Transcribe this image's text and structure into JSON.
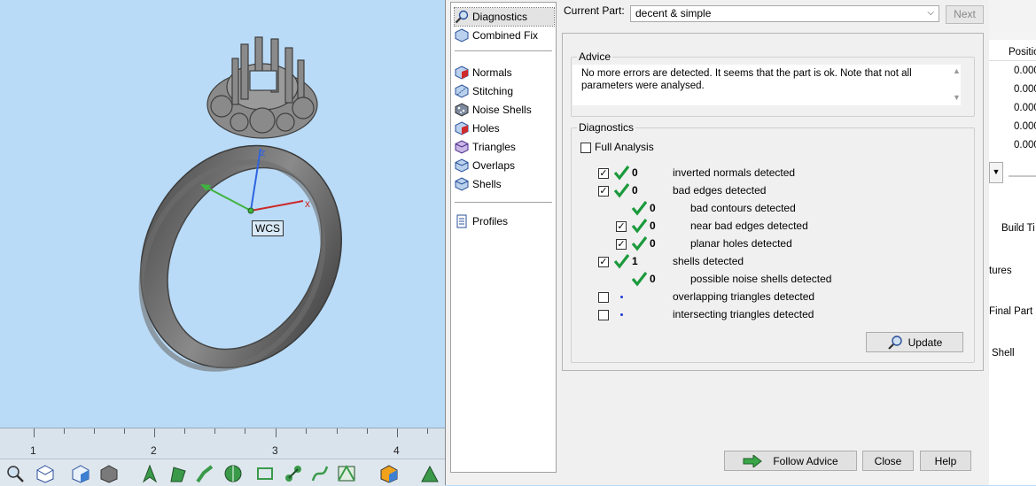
{
  "viewport": {
    "axis_x": "x",
    "axis_y": "y",
    "axis_z": "z",
    "wcs_label": "WCS",
    "ruler_numbers": [
      "1",
      "2",
      "3",
      "4"
    ]
  },
  "toolbar": {
    "icons": [
      "magnifier-icon",
      "cube-wire-icon",
      "cube-front-icon",
      "cube-solid-icon",
      "arrow-select-icon",
      "select-face-icon",
      "select-edge-icon",
      "shell-select-icon",
      "rect-select-icon",
      "connect-icon",
      "curve-icon",
      "triangle-edit-icon",
      "part-color-icon",
      "triangle-icon"
    ]
  },
  "nav": {
    "items": [
      {
        "label": "Diagnostics",
        "icon": "magnifier-icon"
      },
      {
        "label": "Combined Fix",
        "icon": "cube-fix-icon"
      },
      {
        "label": "Normals",
        "icon": "normals-icon"
      },
      {
        "label": "Stitching",
        "icon": "stitching-icon"
      },
      {
        "label": "Noise Shells",
        "icon": "noise-shells-icon"
      },
      {
        "label": "Holes",
        "icon": "holes-icon"
      },
      {
        "label": "Triangles",
        "icon": "triangles-icon"
      },
      {
        "label": "Overlaps",
        "icon": "overlaps-icon"
      },
      {
        "label": "Shells",
        "icon": "shells-icon"
      },
      {
        "label": "Profiles",
        "icon": "profiles-icon"
      }
    ]
  },
  "header": {
    "current_part_label": "Current Part:",
    "current_part_value": "decent & simple",
    "next_label": "Next"
  },
  "advice": {
    "title": "Advice",
    "text": "No more errors are detected. It seems that the part is ok. Note that not all parameters were analysed."
  },
  "diagnostics": {
    "title": "Diagnostics",
    "full_analysis_label": "Full Analysis",
    "rows": [
      {
        "count": "0",
        "label": "inverted normals detected"
      },
      {
        "count": "0",
        "label": "bad edges detected"
      },
      {
        "count": "0",
        "label": "bad contours detected"
      },
      {
        "count": "0",
        "label": "near bad edges detected"
      },
      {
        "count": "0",
        "label": "planar holes detected"
      },
      {
        "count": "1",
        "label": "shells detected"
      },
      {
        "count": "0",
        "label": "possible noise shells detected"
      },
      {
        "count": "",
        "label": "overlapping triangles detected"
      },
      {
        "count": "",
        "label": "intersecting triangles detected"
      }
    ],
    "update_label": "Update"
  },
  "footer": {
    "follow_advice_label": "Follow Advice",
    "close_label": "Close",
    "help_label": "Help"
  },
  "right_panel": {
    "position_header": "Positio",
    "position_values": [
      "0.000",
      "0.000",
      "0.000",
      "0.000",
      "0.000"
    ],
    "build_time_label": "Build Ti",
    "features_label": "tures",
    "final_part_label": "Final Part",
    "shell_label": "Shell"
  },
  "colors": {
    "viewport_bg": "#b9dbf7",
    "check_green": "#1b9a3c",
    "dot_blue": "#1a3bd6"
  }
}
